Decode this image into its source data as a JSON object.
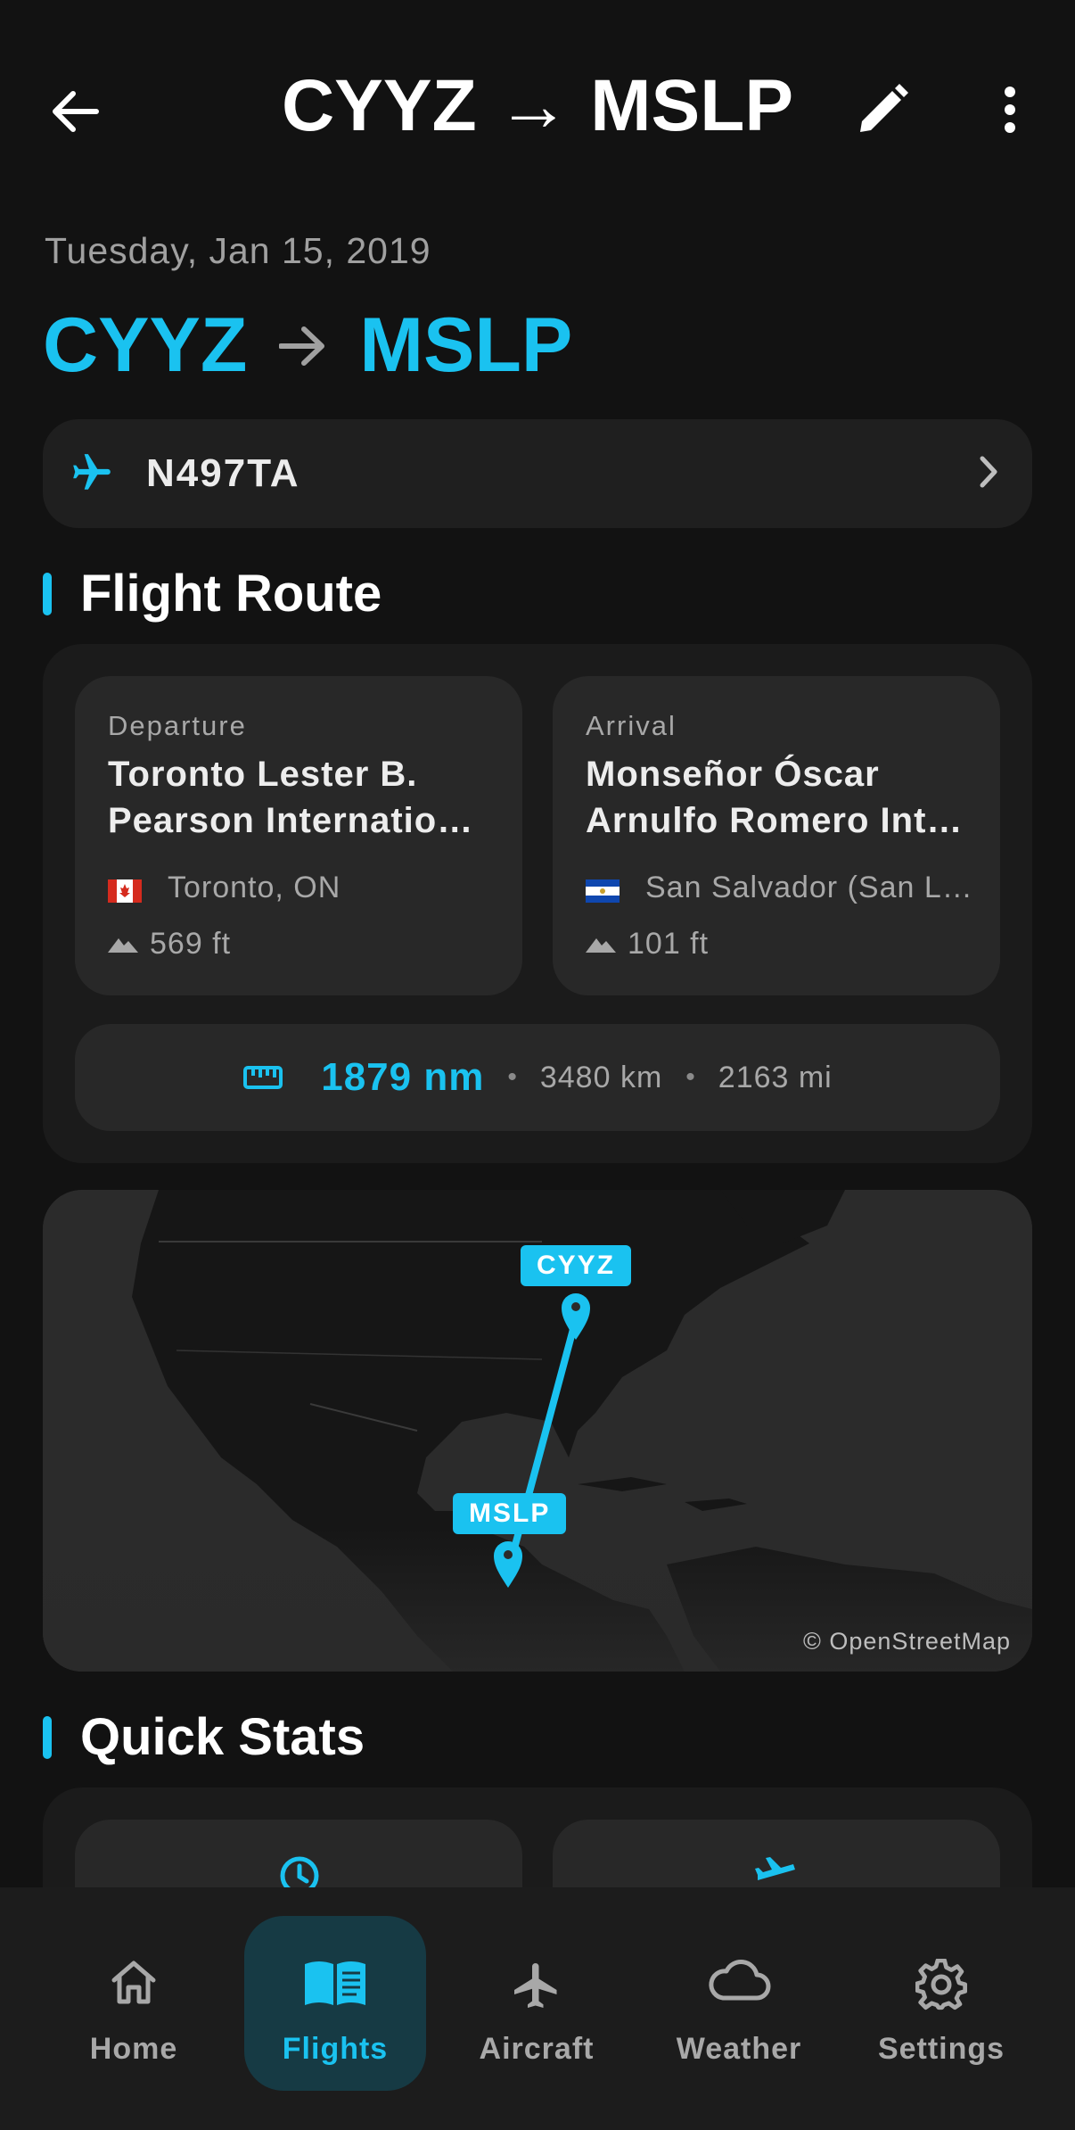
{
  "header": {
    "title": "CYYZ → MSLP"
  },
  "flight": {
    "date": "Tuesday, Jan 15, 2019",
    "origin": "CYYZ",
    "destination": "MSLP",
    "aircraft_registration": "N497TA"
  },
  "route_section": {
    "title": "Flight Route",
    "departure": {
      "label": "Departure",
      "name_line1": "Toronto Lester B.",
      "name_line2": "Pearson Internatio…",
      "city": "Toronto, ON",
      "elevation": "569 ft"
    },
    "arrival": {
      "label": "Arrival",
      "name_line1": "Monseñor Óscar",
      "name_line2": "Arnulfo Romero Int…",
      "city": "San Salvador (San L…",
      "elevation": "101 ft"
    },
    "distance": {
      "nm": "1879 nm",
      "km": "3480 km",
      "mi": "2163 mi"
    }
  },
  "map": {
    "origin_label": "CYYZ",
    "destination_label": "MSLP",
    "credit": "© OpenStreetMap"
  },
  "stats_section": {
    "title": "Quick Stats"
  },
  "nav": {
    "items": [
      {
        "label": "Home",
        "icon": "home-icon",
        "active": false
      },
      {
        "label": "Flights",
        "icon": "book-icon",
        "active": true
      },
      {
        "label": "Aircraft",
        "icon": "airplane-icon",
        "active": false
      },
      {
        "label": "Weather",
        "icon": "cloud-icon",
        "active": false
      },
      {
        "label": "Settings",
        "icon": "gear-icon",
        "active": false
      }
    ]
  },
  "colors": {
    "accent": "#1ac2f0",
    "background": "#121212",
    "card": "#282828",
    "panel": "#1b1b1b",
    "nav_active_bg": "#163a44"
  }
}
